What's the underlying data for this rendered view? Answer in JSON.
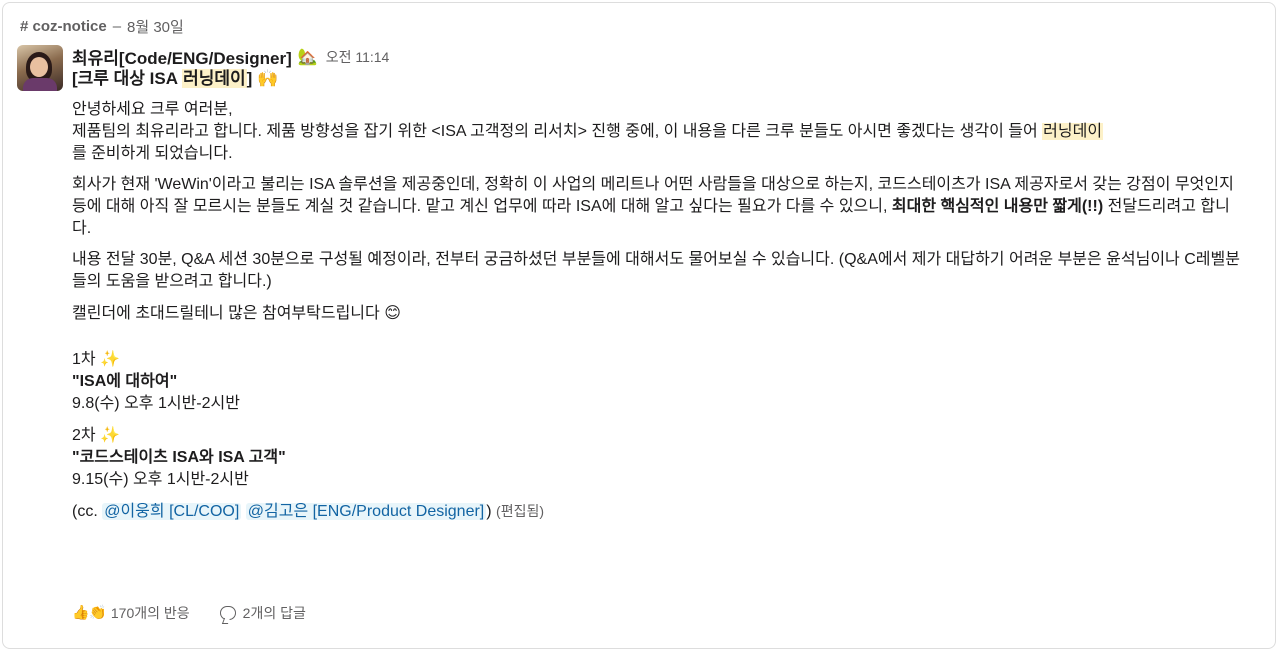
{
  "channel": {
    "name": "# coz-notice",
    "separator": "–",
    "date": "8월 30일"
  },
  "message": {
    "sender": "최유리[Code/ENG/Designer]",
    "status_emoji": "🏡",
    "time": "오전 11:14",
    "title_prefix": "[크루 대상 ISA ",
    "title_highlight": "러닝데이",
    "title_suffix": "]",
    "title_emoji": "🙌",
    "p1_line1": "안녕하세요 크루 여러분,",
    "p1_line2_a": "제품팀의 최유리라고 합니다. 제품 방향성을 잡기 위한 <ISA 고객정의 리서치> 진행 중에, 이 내용을 다른 크루 분들도 아시면 좋겠다는 생각이 들어 ",
    "p1_line2_hl": "러닝데이",
    "p1_line3": "를 준비하게 되었습니다.",
    "p2_a": "회사가 현재 'WeWin'이라고 불리는 ISA 솔루션을 제공중인데, 정확히 이 사업의 메리트나 어떤 사람들을 대상으로 하는지, 코드스테이츠가 ISA 제공자로서 갖는 강점이 무엇인지 등에 대해 아직 잘 모르시는 분들도 계실 것 같습니다. 맡고 계신 업무에 따라 ISA에 대해 알고 싶다는 필요가  다를 수 있으니, ",
    "p2_bold": "최대한 핵심적인 내용만 짧게(!!)",
    "p2_b": " 전달드리려고 합니다.",
    "p3": "내용 전달 30분, Q&A 세션 30분으로 구성될 예정이라, 전부터 궁금하셨던 부분들에 대해서도 물어보실 수 있습니다. (Q&A에서 제가 대답하기 어려운 부분은 윤석님이나 C레벨분들의 도움을 받으려고 합니다.)",
    "p4": "캘린더에 초대드릴테니 많은 참여부탁드립니다 ",
    "p4_emoji": "😊",
    "session1": {
      "label": "1차 ",
      "emoji": "✨",
      "topic": "\"ISA에 대하여\"",
      "when": "9.8(수) 오후 1시반-2시반"
    },
    "session2": {
      "label": "2차 ",
      "emoji": "✨",
      "topic": "\"코드스테이츠 ISA와 ISA 고객\"",
      "when": "9.15(수) 오후 1시반-2시반"
    },
    "cc_prefix": "(cc. ",
    "mention1": "@이웅희 [CL/COO]",
    "mention2": "@김고은 [ENG/Product Designer]",
    "cc_suffix": ")",
    "edited": "(편집됨)"
  },
  "footer": {
    "reaction_emojis": "👍👏",
    "reactions_label": "170개의 반응",
    "replies_label": "2개의 답글"
  }
}
